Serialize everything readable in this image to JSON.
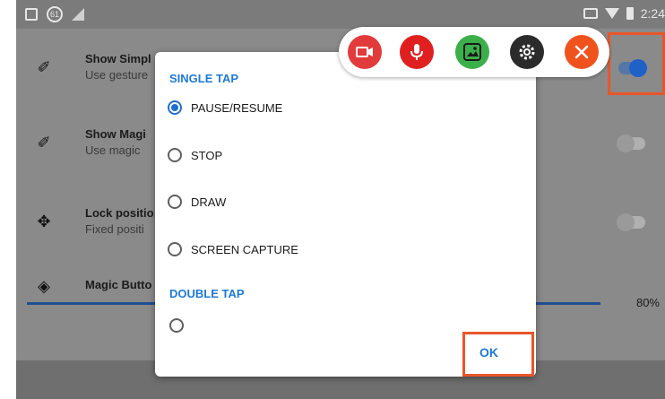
{
  "status_bar": {
    "notif_count": "61",
    "time": "2:24"
  },
  "settings": {
    "rows": [
      {
        "title": "Show Simpl",
        "subtitle": "Use gesture"
      },
      {
        "title": "Show Magi",
        "subtitle": "Use magic"
      },
      {
        "title": "Lock positio",
        "subtitle": "Fixed positi"
      },
      {
        "title": "Magic Butto",
        "subtitle": ""
      }
    ],
    "slider_value": "80%"
  },
  "dialog": {
    "section_single": "SINGLE TAP",
    "options": [
      {
        "label": "PAUSE/RESUME",
        "selected": true
      },
      {
        "label": "STOP",
        "selected": false
      },
      {
        "label": "DRAW",
        "selected": false
      },
      {
        "label": "SCREEN CAPTURE",
        "selected": false
      }
    ],
    "section_double": "DOUBLE TAP",
    "ok_label": "OK"
  },
  "toolbar": {
    "buttons": [
      "video-camera-icon",
      "microphone-icon",
      "image-icon",
      "gear-icon",
      "close-icon"
    ],
    "colors": {
      "video": "#e23b3b",
      "mic": "#e02020",
      "image": "#3bb04a",
      "gear": "#2b2b2b",
      "close": "#f0521e"
    }
  },
  "colors": {
    "accent": "#1e7ad6",
    "highlight": "#e8562b"
  }
}
